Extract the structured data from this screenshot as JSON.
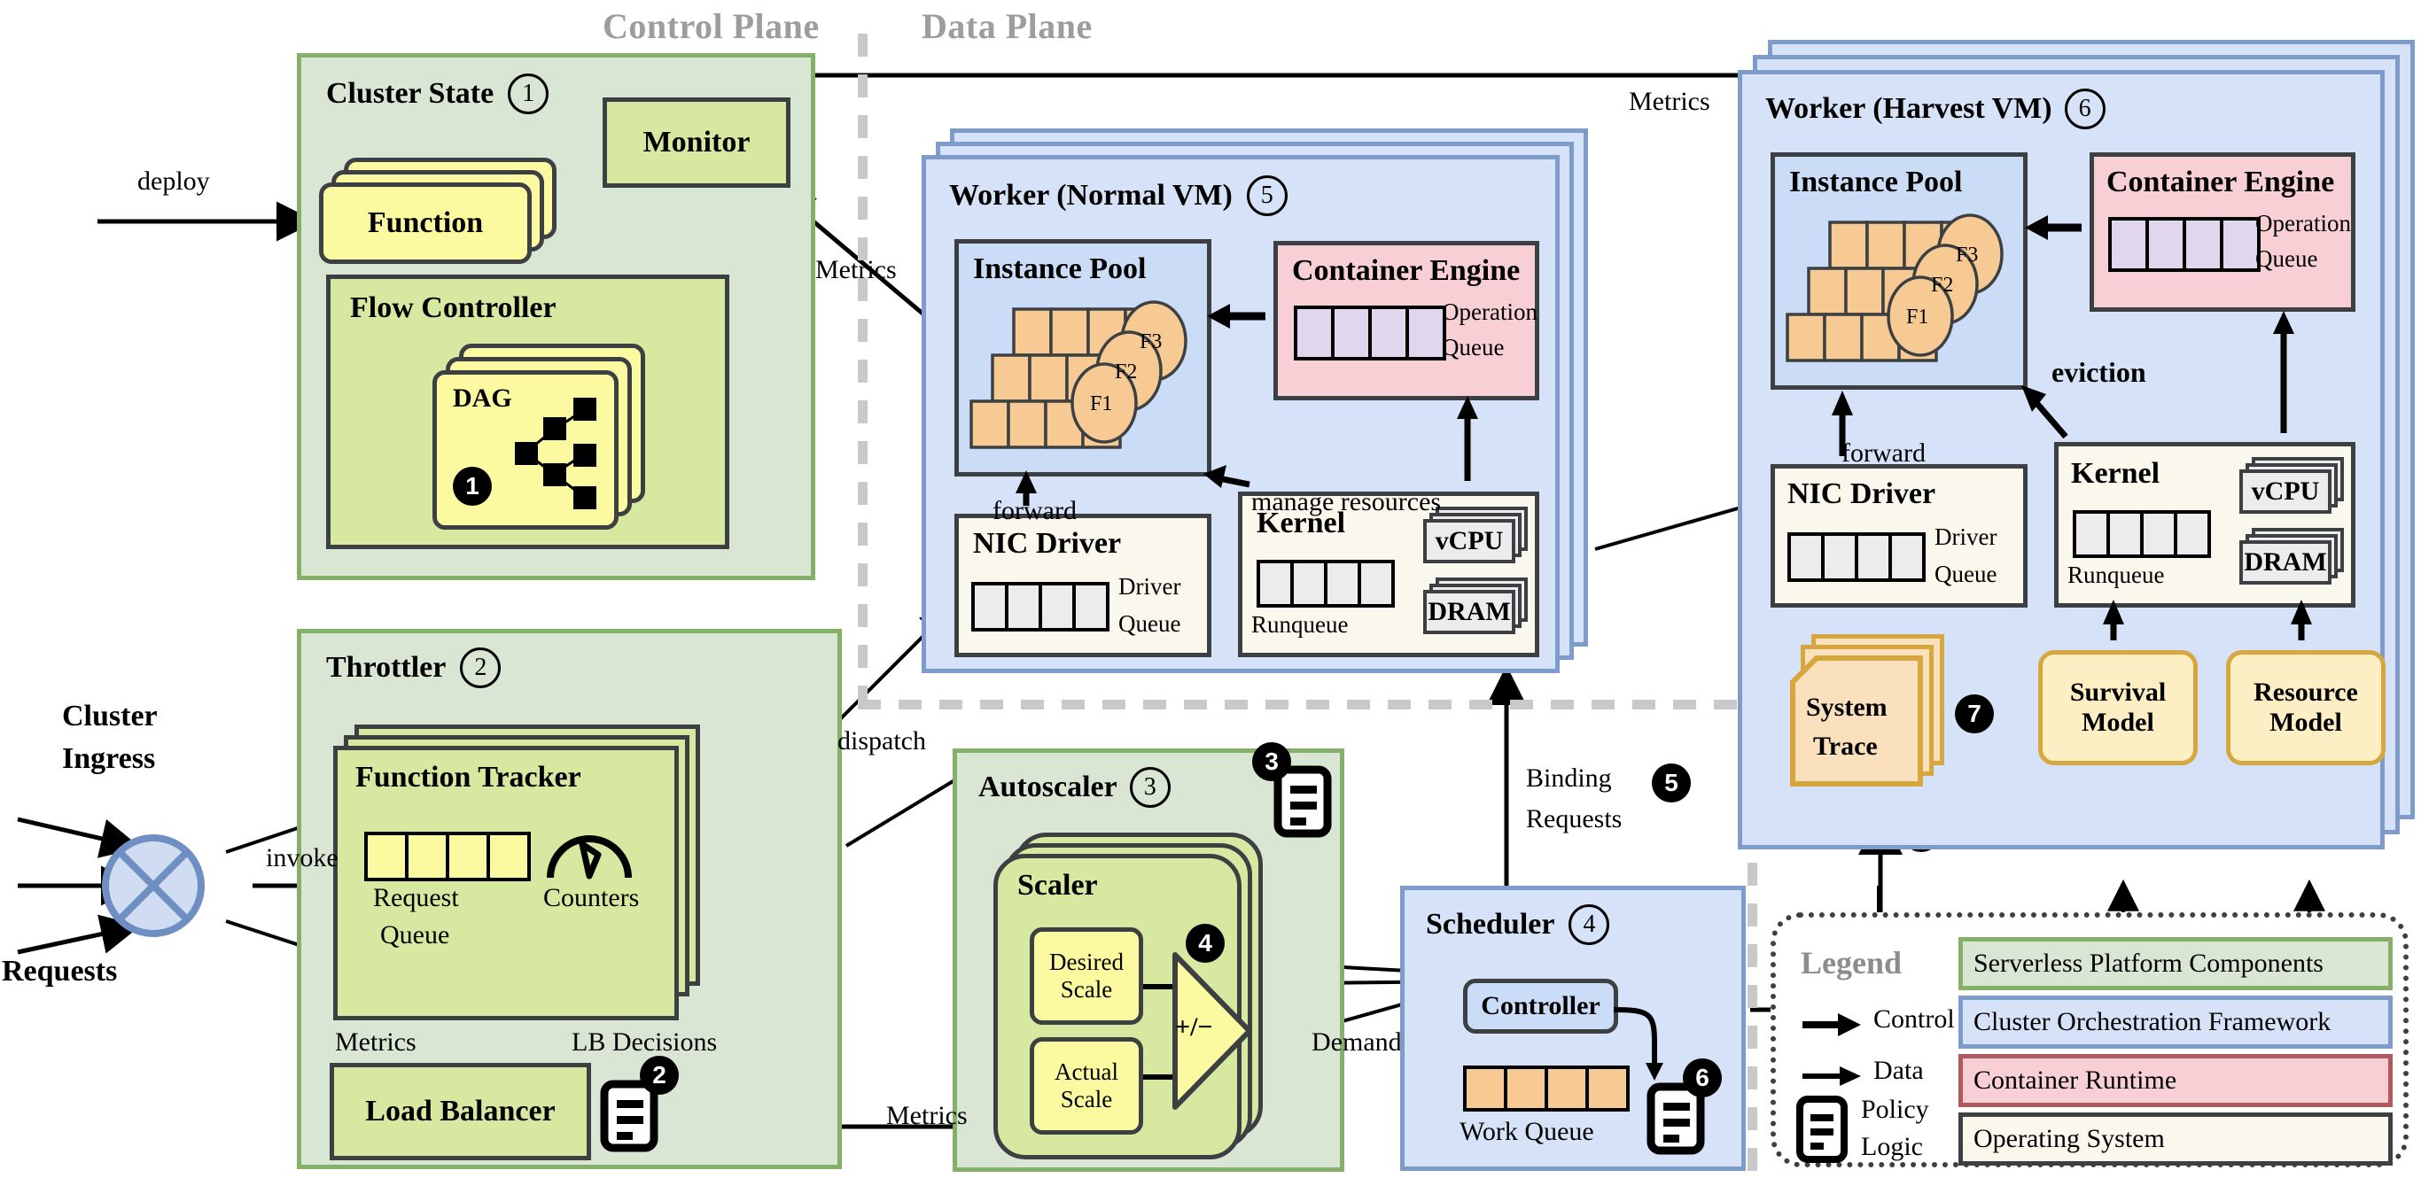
{
  "planes": {
    "control": "Control Plane",
    "data": "Data Plane"
  },
  "cluster_state": {
    "title": "Cluster State",
    "badge": "1",
    "deploy_label": "deploy",
    "function_card": "Function",
    "flow_controller": "Flow Controller",
    "dag_card": "DAG",
    "dag_badge": "1"
  },
  "monitor": {
    "title": "Monitor"
  },
  "throttler": {
    "title": "Throttler",
    "badge": "2",
    "function_tracker": "Function Tracker",
    "request_queue_line1": "Request",
    "request_queue_line2": "Queue",
    "counters": "Counters",
    "metrics": "Metrics",
    "lb_decisions": "LB Decisions",
    "load_balancer": "Load Balancer",
    "policy_badge": "2"
  },
  "ingress": {
    "title_line1": "Cluster",
    "title_line2": "Ingress",
    "requests": "Requests",
    "invoke": "invoke"
  },
  "autoscaler": {
    "title": "Autoscaler",
    "badge": "3",
    "policy_badge": "3",
    "scaler": "Scaler",
    "desired_line1": "Desired",
    "desired_line2": "Scale",
    "actual_line1": "Actual",
    "actual_line2": "Scale",
    "op": "+/−",
    "op_badge": "4",
    "metrics_in": "Metrics",
    "demands": "Demands"
  },
  "scheduler": {
    "title": "Scheduler",
    "badge": "4",
    "controller": "Controller",
    "work_queue": "Work Queue",
    "policy_badge": "6",
    "binding_line1": "Binding",
    "binding_line2": "Requests",
    "binding_badge": "5",
    "trace_badge": "5"
  },
  "worker_normal": {
    "title": "Worker (Normal VM)",
    "badge": "5",
    "instance_pool": "Instance Pool",
    "instances": [
      "F1",
      "F2",
      "F3"
    ],
    "container_engine": "Container Engine",
    "op_queue_line1": "Operation",
    "op_queue_line2": "Queue",
    "nic_driver": "NIC Driver",
    "driver_queue_line1": "Driver",
    "driver_queue_line2": "Queue",
    "kernel": "Kernel",
    "runqueue": "Runqueue",
    "vcpu": "vCPU",
    "dram": "DRAM",
    "forward": "forward",
    "manage_resources": "manage resources",
    "metrics": "Metrics",
    "dispatch": "dispatch"
  },
  "worker_harvest": {
    "title": "Worker (Harvest VM)",
    "badge": "6",
    "instance_pool": "Instance Pool",
    "instances": [
      "F1",
      "F2",
      "F3"
    ],
    "container_engine": "Container Engine",
    "op_queue_line1": "Operation",
    "op_queue_line2": "Queue",
    "nic_driver": "NIC Driver",
    "driver_queue_line1": "Driver",
    "driver_queue_line2": "Queue",
    "kernel": "Kernel",
    "runqueue": "Runqueue",
    "vcpu": "vCPU",
    "dram": "DRAM",
    "forward": "forward",
    "eviction": "eviction",
    "metrics": "Metrics",
    "system_trace_line1": "System",
    "system_trace_line2": "Trace",
    "trace_badge": "7",
    "survival_line1": "Survival",
    "survival_line2": "Model",
    "resource_line1": "Resource",
    "resource_line2": "Model"
  },
  "legend": {
    "title": "Legend",
    "control": "Control",
    "data": "Data",
    "policy_line1": "Policy",
    "policy_line2": "Logic",
    "rows": [
      {
        "label": "Serverless Platform Components",
        "fill": "#d9e6d4",
        "border": "#84b06a"
      },
      {
        "label": "Cluster Orchestration Framework",
        "fill": "#d6e2f7",
        "border": "#7d9cc9"
      },
      {
        "label": "Container Runtime",
        "fill": "#f7cfd4",
        "border": "#b05a5f"
      },
      {
        "label": "Operating System",
        "fill": "#faf7ec",
        "border": "#3c4043"
      }
    ]
  },
  "colors": {
    "green_fill": "#d9e6d4",
    "green_border": "#84b06a",
    "green_inner": "#d7e8a0",
    "yellow": "#fcfaa0",
    "blue_fill": "#d6e2f7",
    "blue_border": "#7d9cc9",
    "pink": "#f7cfd4",
    "os": "#faf7ec",
    "orange": "#f7ca93",
    "tan": "#fdeec4",
    "tan_border": "#d6a73f",
    "plane_label": "#9d9d9d",
    "dash": "#c9c9c9"
  }
}
